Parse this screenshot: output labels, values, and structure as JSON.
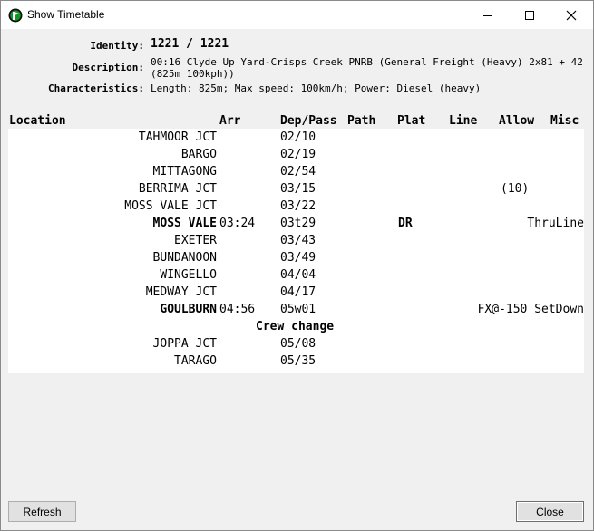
{
  "window": {
    "title": "Show Timetable"
  },
  "info": {
    "identity_label": "Identity:",
    "identity_value": "1221 / 1221",
    "description_label": "Description:",
    "description_line1": "00:16 Clyde Up Yard-Crisps Creek PNRB (General Freight (Heavy) 2x81 + 42",
    "description_line2": "(825m 100kph))",
    "characteristics_label": "Characteristics:",
    "characteristics_value": "Length: 825m; Max speed: 100km/h; Power: Diesel (heavy)"
  },
  "table": {
    "columns": {
      "location": "Location",
      "arr": "Arr",
      "dep": "Dep/Pass",
      "path": "Path",
      "plat": "Plat",
      "line": "Line",
      "allow": "Allow",
      "misc": "Misc"
    },
    "rows": [
      {
        "location": "TAHMOOR JCT",
        "arr": "",
        "dep": "02/10",
        "plat": "",
        "allow": "",
        "misc": ""
      },
      {
        "location": "BARGO",
        "arr": "",
        "dep": "02/19",
        "plat": "",
        "allow": "",
        "misc": ""
      },
      {
        "location": "MITTAGONG",
        "arr": "",
        "dep": "02/54",
        "plat": "",
        "allow": "",
        "misc": ""
      },
      {
        "location": "BERRIMA JCT",
        "arr": "",
        "dep": "03/15",
        "plat": "",
        "allow": "(10)",
        "misc": ""
      },
      {
        "location": "MOSS VALE JCT",
        "arr": "",
        "dep": "03/22",
        "plat": "",
        "allow": "",
        "misc": ""
      },
      {
        "location": "MOSS VALE",
        "arr": "03:24",
        "dep": "03t29",
        "plat": "DR",
        "allow": "",
        "misc": "ThruLine"
      },
      {
        "location": "EXETER",
        "arr": "",
        "dep": "03/43",
        "plat": "",
        "allow": "",
        "misc": ""
      },
      {
        "location": "BUNDANOON",
        "arr": "",
        "dep": "03/49",
        "plat": "",
        "allow": "",
        "misc": ""
      },
      {
        "location": "WINGELLO",
        "arr": "",
        "dep": "04/04",
        "plat": "",
        "allow": "",
        "misc": ""
      },
      {
        "location": "MEDWAY JCT",
        "arr": "",
        "dep": "04/17",
        "plat": "",
        "allow": "",
        "misc": ""
      },
      {
        "location": "GOULBURN",
        "arr": "04:56",
        "dep": "05w01",
        "plat": "",
        "allow": "",
        "misc": "FX@-150 SetDown"
      },
      {
        "crew_change": "Crew change"
      },
      {
        "location": "JOPPA JCT",
        "arr": "",
        "dep": "05/08",
        "plat": "",
        "allow": "",
        "misc": ""
      },
      {
        "location": "TARAGO",
        "arr": "",
        "dep": "05/35",
        "plat": "",
        "allow": "",
        "misc": ""
      }
    ]
  },
  "buttons": {
    "refresh": "Refresh",
    "close": "Close"
  }
}
